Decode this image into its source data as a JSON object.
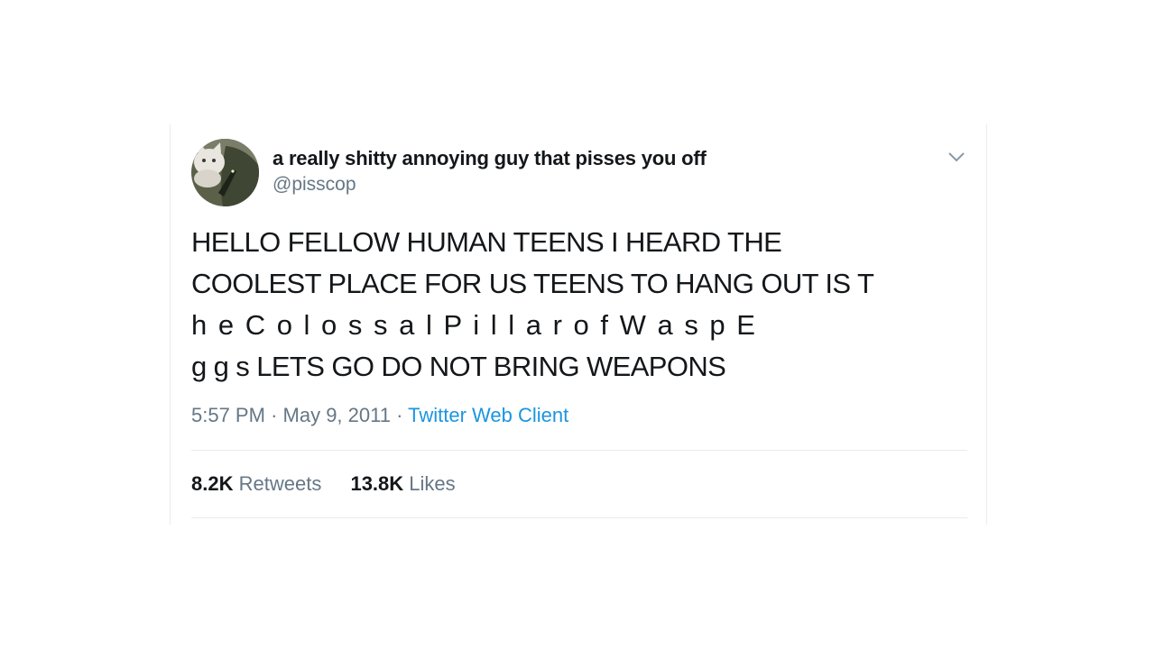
{
  "tweet": {
    "author": {
      "display_name": "a really shitty annoying guy that pisses you off",
      "handle": "@pisscop",
      "avatar_icon": "cat-avatar"
    },
    "menu_icon": "chevron-down-icon",
    "text_lines": [
      "HELLO FELLOW HUMAN TEENS I HEARD THE",
      "COOLEST PLACE FOR US TEENS TO HANG OUT IS  T",
      "h e C o l o s s a l  P i l l a r  o f  W a s p  E",
      "g g s  LETS GO DO NOT BRING WEAPONS"
    ],
    "time": "5:57 PM",
    "date": "May 9, 2011",
    "source": "Twitter Web Client",
    "separator": "·",
    "retweets": {
      "count": "8.2K",
      "label": "Retweets"
    },
    "likes": {
      "count": "13.8K",
      "label": "Likes"
    }
  },
  "colors": {
    "text": "#14171a",
    "secondary": "#657786",
    "link": "#1b95e0",
    "divider": "#e6ecf0"
  }
}
